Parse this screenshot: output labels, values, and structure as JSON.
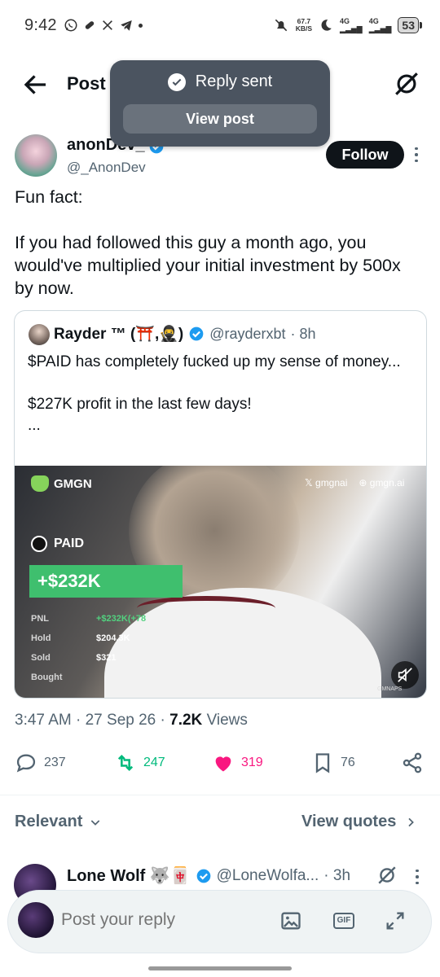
{
  "status_bar": {
    "time": "9:42",
    "net_speed_value": "67.7",
    "net_speed_unit": "KB/S",
    "sig1": "4G",
    "sig2": "4G",
    "battery": "53"
  },
  "header": {
    "title": "Post"
  },
  "toast": {
    "message": "Reply sent",
    "button": "View post"
  },
  "post": {
    "author_name": "anonDev_",
    "author_handle": "@_AnonDev",
    "follow_label": "Follow",
    "text": "Fun fact:\n\nIf you had followed this guy a month ago, you would've multiplied your initial investment by 500x by now.",
    "time": "3:47 AM",
    "date": "27 Sep 26",
    "views_count": "7.2K",
    "views_label": "Views"
  },
  "quote": {
    "name": "Rayder ™ (⛩️,🥷)",
    "handle": "@rayderxbt",
    "time": "· 8h",
    "text": "$PAID has completely fucked up my sense of money...\n\n$227K profit in the last few days!\n...",
    "media": {
      "brand": "GMGN",
      "link_x": "gmgnai",
      "link_web": "gmgn.ai",
      "token": "PAID",
      "pnl_big": "+$232K",
      "rows": [
        {
          "label": "PNL",
          "value": "+$232K(+78"
        },
        {
          "label": "Hold",
          "value": "$204.3K"
        },
        {
          "label": "Sold",
          "value": "$321"
        },
        {
          "label": "Bought",
          "value": ""
        }
      ],
      "watermark": "GMNAPS"
    }
  },
  "actions": {
    "replies": "237",
    "reposts": "247",
    "likes": "319",
    "bookmarks": "76"
  },
  "sort": {
    "relevant": "Relevant",
    "view_quotes": "View quotes"
  },
  "reply_preview": {
    "name": "Lone Wolf 🐺🀄",
    "handle": "@LoneWolfa...",
    "time": "· 3h"
  },
  "composer": {
    "placeholder": "Post your reply",
    "gif_label": "GIF"
  },
  "colors": {
    "verified": "#1d9bf0",
    "repost": "#00ba7c",
    "like": "#f91880",
    "accent_green": "#3fbf6e"
  }
}
